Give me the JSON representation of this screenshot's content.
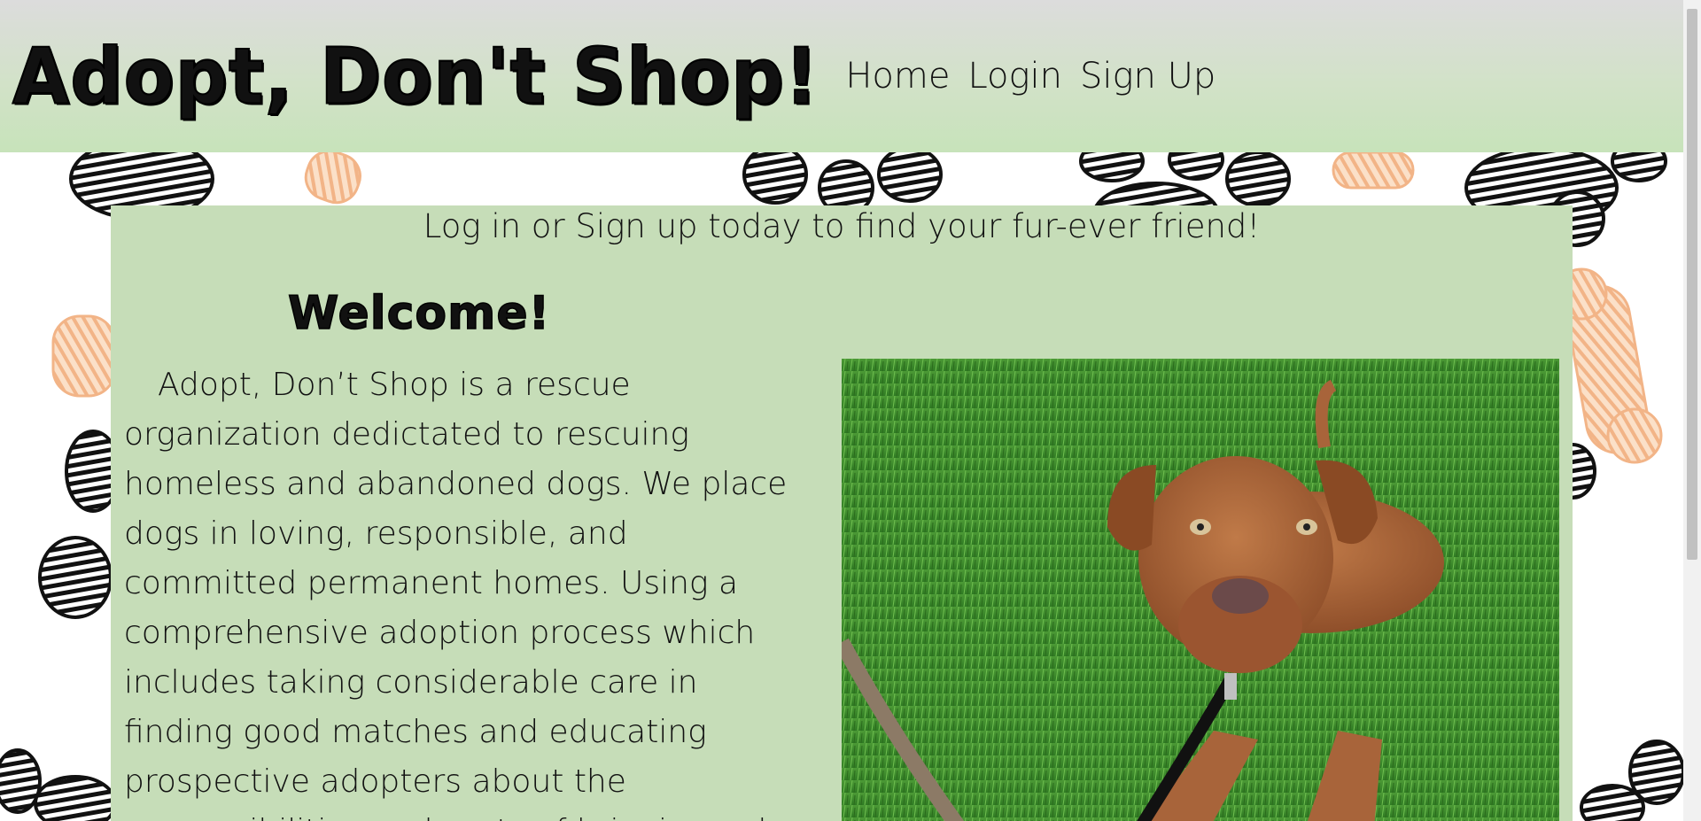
{
  "header": {
    "brand": "Adopt, Don't Shop!",
    "nav": [
      "Home",
      "Login",
      "Sign Up"
    ]
  },
  "main": {
    "tagline": "Log in or Sign up today to find your fur-ever friend!",
    "welcome": "Welcome!",
    "about": "Adopt, Don’t Shop is a rescue organization dedictated to rescuing homeless and abandoned dogs. We place dogs in loving, responsible, and committed permanent homes. Using a comprehensive adoption process which includes taking considerable care in finding good matches and educating prospective adopters about the responsibilities and costs of bringing a dog",
    "photo_alt": "dog-photo"
  },
  "colors": {
    "header_gradient_top": "#dcdcdc",
    "header_gradient_bottom": "#c7e3ba",
    "panel": "#c6ddb8",
    "paw": "#111111",
    "bone": "#f5c59d",
    "grass": "#3f8a2a",
    "dog": "#a8643a"
  }
}
